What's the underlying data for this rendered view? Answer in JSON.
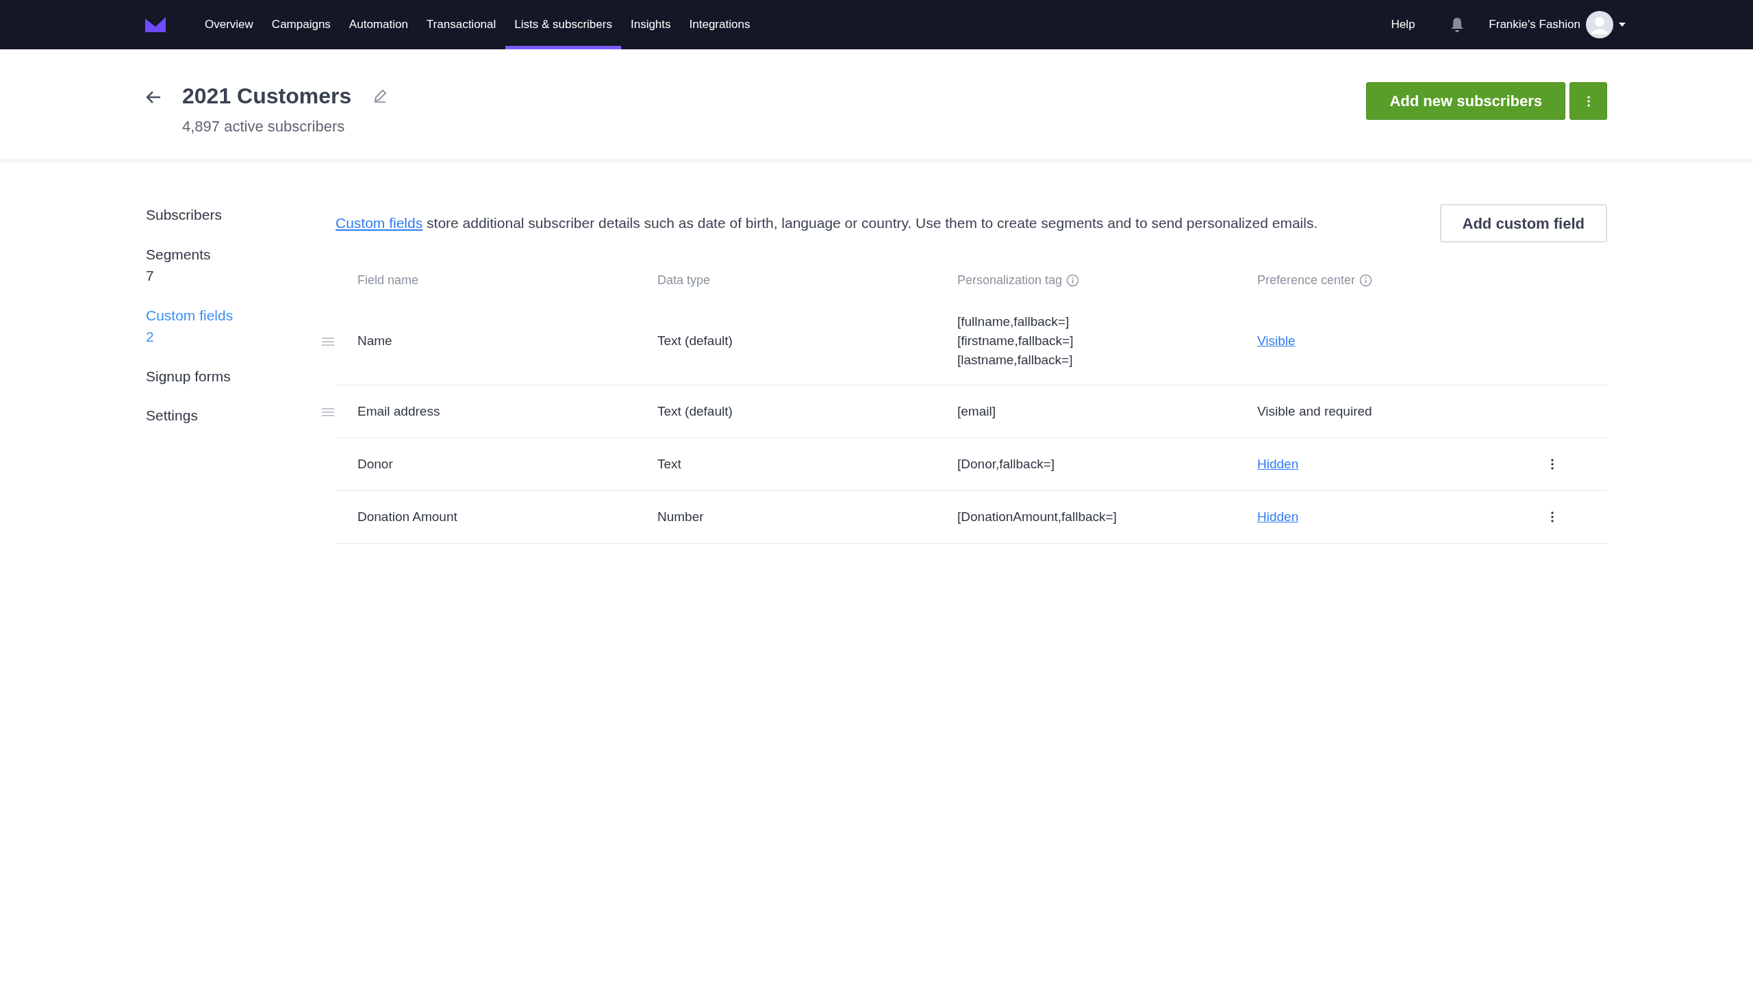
{
  "nav": {
    "items": [
      {
        "label": "Overview",
        "selected": false
      },
      {
        "label": "Campaigns",
        "selected": false
      },
      {
        "label": "Automation",
        "selected": false
      },
      {
        "label": "Transactional",
        "selected": false
      },
      {
        "label": "Lists & subscribers",
        "selected": true
      },
      {
        "label": "Insights",
        "selected": false
      },
      {
        "label": "Integrations",
        "selected": false
      }
    ],
    "help": "Help",
    "account": "Frankie's Fashion"
  },
  "header": {
    "title": "2021 Customers",
    "subtitle": "4,897 active subscribers",
    "primary_button": "Add new subscribers"
  },
  "sidebar": {
    "items": [
      {
        "label": "Subscribers",
        "selected": false
      },
      {
        "label": "Segments",
        "count": "7",
        "selected": false
      },
      {
        "label": "Custom fields",
        "count": "2",
        "selected": true
      },
      {
        "label": "Signup forms",
        "selected": false
      },
      {
        "label": "Settings",
        "selected": false
      }
    ]
  },
  "intro": {
    "link": "Custom fields",
    "text": "store additional subscriber details such as date of birth, language or country. Use them to create segments and to send personalized emails."
  },
  "add_button": "Add custom field",
  "table": {
    "columns": [
      {
        "label": "Field name",
        "info": false
      },
      {
        "label": "Data type",
        "info": false
      },
      {
        "label": "Personalization tag",
        "info": true
      },
      {
        "label": "Preference center",
        "info": true
      }
    ],
    "rows": [
      {
        "field_name": "Name",
        "data_type": "Text (default)",
        "tags": [
          "[fullname,fallback=]",
          "[firstname,fallback=]",
          "[lastname,fallback=]"
        ],
        "preference": {
          "kind": "link",
          "text": "Visible"
        },
        "draggable": true,
        "menu": false
      },
      {
        "field_name": "Email address",
        "data_type": "Text (default)",
        "tags": [
          "[email]"
        ],
        "preference": {
          "kind": "text",
          "text": "Visible and required"
        },
        "draggable": true,
        "menu": false
      },
      {
        "field_name": "Donor",
        "data_type": "Text",
        "tags": [
          "[Donor,fallback=]"
        ],
        "preference": {
          "kind": "link",
          "text": "Hidden"
        },
        "draggable": false,
        "menu": true
      },
      {
        "field_name": "Donation Amount",
        "data_type": "Number",
        "tags": [
          "[DonationAmount,fallback=]"
        ],
        "preference": {
          "kind": "link",
          "text": "Hidden"
        },
        "draggable": false,
        "menu": true
      }
    ]
  }
}
